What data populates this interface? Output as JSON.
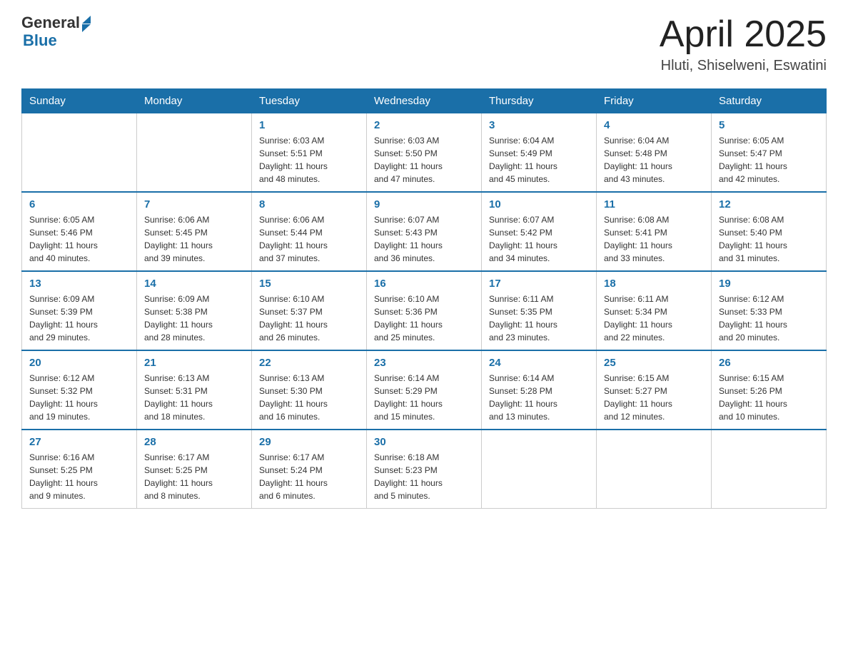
{
  "header": {
    "logo_general": "General",
    "logo_blue": "Blue",
    "month_title": "April 2025",
    "location": "Hluti, Shiselweni, Eswatini"
  },
  "weekdays": [
    "Sunday",
    "Monday",
    "Tuesday",
    "Wednesday",
    "Thursday",
    "Friday",
    "Saturday"
  ],
  "weeks": [
    [
      {
        "day": "",
        "info": ""
      },
      {
        "day": "",
        "info": ""
      },
      {
        "day": "1",
        "info": "Sunrise: 6:03 AM\nSunset: 5:51 PM\nDaylight: 11 hours\nand 48 minutes."
      },
      {
        "day": "2",
        "info": "Sunrise: 6:03 AM\nSunset: 5:50 PM\nDaylight: 11 hours\nand 47 minutes."
      },
      {
        "day": "3",
        "info": "Sunrise: 6:04 AM\nSunset: 5:49 PM\nDaylight: 11 hours\nand 45 minutes."
      },
      {
        "day": "4",
        "info": "Sunrise: 6:04 AM\nSunset: 5:48 PM\nDaylight: 11 hours\nand 43 minutes."
      },
      {
        "day": "5",
        "info": "Sunrise: 6:05 AM\nSunset: 5:47 PM\nDaylight: 11 hours\nand 42 minutes."
      }
    ],
    [
      {
        "day": "6",
        "info": "Sunrise: 6:05 AM\nSunset: 5:46 PM\nDaylight: 11 hours\nand 40 minutes."
      },
      {
        "day": "7",
        "info": "Sunrise: 6:06 AM\nSunset: 5:45 PM\nDaylight: 11 hours\nand 39 minutes."
      },
      {
        "day": "8",
        "info": "Sunrise: 6:06 AM\nSunset: 5:44 PM\nDaylight: 11 hours\nand 37 minutes."
      },
      {
        "day": "9",
        "info": "Sunrise: 6:07 AM\nSunset: 5:43 PM\nDaylight: 11 hours\nand 36 minutes."
      },
      {
        "day": "10",
        "info": "Sunrise: 6:07 AM\nSunset: 5:42 PM\nDaylight: 11 hours\nand 34 minutes."
      },
      {
        "day": "11",
        "info": "Sunrise: 6:08 AM\nSunset: 5:41 PM\nDaylight: 11 hours\nand 33 minutes."
      },
      {
        "day": "12",
        "info": "Sunrise: 6:08 AM\nSunset: 5:40 PM\nDaylight: 11 hours\nand 31 minutes."
      }
    ],
    [
      {
        "day": "13",
        "info": "Sunrise: 6:09 AM\nSunset: 5:39 PM\nDaylight: 11 hours\nand 29 minutes."
      },
      {
        "day": "14",
        "info": "Sunrise: 6:09 AM\nSunset: 5:38 PM\nDaylight: 11 hours\nand 28 minutes."
      },
      {
        "day": "15",
        "info": "Sunrise: 6:10 AM\nSunset: 5:37 PM\nDaylight: 11 hours\nand 26 minutes."
      },
      {
        "day": "16",
        "info": "Sunrise: 6:10 AM\nSunset: 5:36 PM\nDaylight: 11 hours\nand 25 minutes."
      },
      {
        "day": "17",
        "info": "Sunrise: 6:11 AM\nSunset: 5:35 PM\nDaylight: 11 hours\nand 23 minutes."
      },
      {
        "day": "18",
        "info": "Sunrise: 6:11 AM\nSunset: 5:34 PM\nDaylight: 11 hours\nand 22 minutes."
      },
      {
        "day": "19",
        "info": "Sunrise: 6:12 AM\nSunset: 5:33 PM\nDaylight: 11 hours\nand 20 minutes."
      }
    ],
    [
      {
        "day": "20",
        "info": "Sunrise: 6:12 AM\nSunset: 5:32 PM\nDaylight: 11 hours\nand 19 minutes."
      },
      {
        "day": "21",
        "info": "Sunrise: 6:13 AM\nSunset: 5:31 PM\nDaylight: 11 hours\nand 18 minutes."
      },
      {
        "day": "22",
        "info": "Sunrise: 6:13 AM\nSunset: 5:30 PM\nDaylight: 11 hours\nand 16 minutes."
      },
      {
        "day": "23",
        "info": "Sunrise: 6:14 AM\nSunset: 5:29 PM\nDaylight: 11 hours\nand 15 minutes."
      },
      {
        "day": "24",
        "info": "Sunrise: 6:14 AM\nSunset: 5:28 PM\nDaylight: 11 hours\nand 13 minutes."
      },
      {
        "day": "25",
        "info": "Sunrise: 6:15 AM\nSunset: 5:27 PM\nDaylight: 11 hours\nand 12 minutes."
      },
      {
        "day": "26",
        "info": "Sunrise: 6:15 AM\nSunset: 5:26 PM\nDaylight: 11 hours\nand 10 minutes."
      }
    ],
    [
      {
        "day": "27",
        "info": "Sunrise: 6:16 AM\nSunset: 5:25 PM\nDaylight: 11 hours\nand 9 minutes."
      },
      {
        "day": "28",
        "info": "Sunrise: 6:17 AM\nSunset: 5:25 PM\nDaylight: 11 hours\nand 8 minutes."
      },
      {
        "day": "29",
        "info": "Sunrise: 6:17 AM\nSunset: 5:24 PM\nDaylight: 11 hours\nand 6 minutes."
      },
      {
        "day": "30",
        "info": "Sunrise: 6:18 AM\nSunset: 5:23 PM\nDaylight: 11 hours\nand 5 minutes."
      },
      {
        "day": "",
        "info": ""
      },
      {
        "day": "",
        "info": ""
      },
      {
        "day": "",
        "info": ""
      }
    ]
  ]
}
